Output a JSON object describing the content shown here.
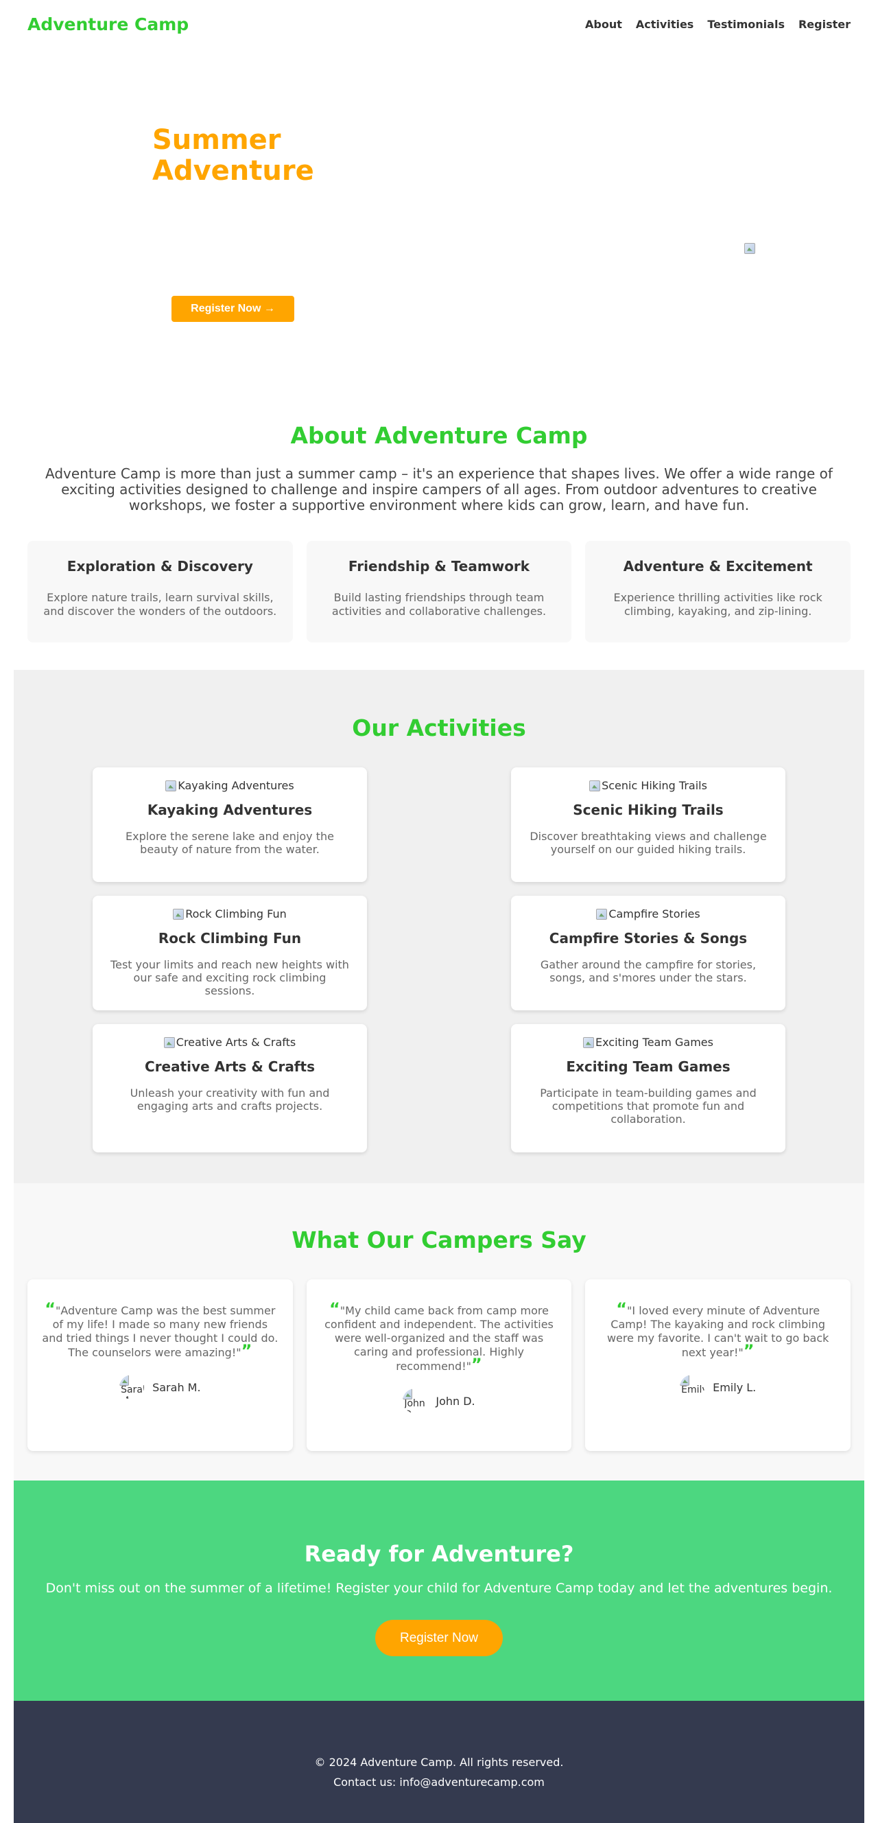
{
  "header": {
    "logo": "Adventure Camp",
    "nav": [
      "About",
      "Activities",
      "Testimonials",
      "Register"
    ]
  },
  "hero": {
    "title_line1": "Summer",
    "title_line2": "Adventure",
    "button": "Register Now →"
  },
  "about": {
    "title": "About Adventure Camp",
    "text": "Adventure Camp is more than just a summer camp – it's an experience that shapes lives. We offer a wide range of exciting activities designed to challenge and inspire campers of all ages. From outdoor adventures to creative workshops, we foster a supportive environment where kids can grow, learn, and have fun.",
    "features": [
      {
        "title": "Exploration & Discovery",
        "text": "Explore nature trails, learn survival skills, and discover the wonders of the outdoors."
      },
      {
        "title": "Friendship & Teamwork",
        "text": "Build lasting friendships through team activities and collaborative challenges."
      },
      {
        "title": "Adventure & Excitement",
        "text": "Experience thrilling activities like rock climbing, kayaking, and zip-lining."
      }
    ]
  },
  "activities": {
    "title": "Our Activities",
    "items": [
      {
        "alt": "Kayaking Adventures",
        "title": "Kayaking Adventures",
        "text": "Explore the serene lake and enjoy the beauty of nature from the water."
      },
      {
        "alt": "Scenic Hiking Trails",
        "title": "Scenic Hiking Trails",
        "text": "Discover breathtaking views and challenge yourself on our guided hiking trails."
      },
      {
        "alt": "Rock Climbing Fun",
        "title": "Rock Climbing Fun",
        "text": "Test your limits and reach new heights with our safe and exciting rock climbing sessions."
      },
      {
        "alt": "Campfire Stories",
        "title": "Campfire Stories & Songs",
        "text": "Gather around the campfire for stories, songs, and s'mores under the stars."
      },
      {
        "alt": "Creative Arts & Crafts",
        "title": "Creative Arts & Crafts",
        "text": "Unleash your creativity with fun and engaging arts and crafts projects."
      },
      {
        "alt": "Exciting Team Games",
        "title": "Exciting Team Games",
        "text": "Participate in team-building games and competitions that promote fun and collaboration."
      }
    ]
  },
  "testimonials": {
    "title": "What Our Campers Say",
    "open_quote": "“",
    "close_quote": "”",
    "items": [
      {
        "quote": "\"Adventure Camp was the best summer of my life! I made so many new friends and tried things I never thought I could do. The counselors were amazing!\"",
        "avatar_alt": "Sarah M.",
        "author": "Sarah M."
      },
      {
        "quote": "\"My child came back from camp more confident and independent. The activities were well-organized and the staff was caring and professional. Highly recommend!\"",
        "avatar_alt": "John D.",
        "author": "John D."
      },
      {
        "quote": "\"I loved every minute of Adventure Camp! The kayaking and rock climbing were my favorite. I can't wait to go back next year!\"",
        "avatar_alt": "Emily L.",
        "author": "Emily L."
      }
    ]
  },
  "cta": {
    "title": "Ready for Adventure?",
    "text": "Don't miss out on the summer of a lifetime! Register your child for Adventure Camp today and let the adventures begin.",
    "button": "Register Now"
  },
  "footer": {
    "copyright": "© 2024 Adventure Camp. All rights reserved.",
    "contact": "Contact us: info@adventurecamp.com"
  },
  "colors": {
    "brand_green": "#32cd32",
    "accent_orange": "#ffa500",
    "cta_green": "#4cd780",
    "footer_navy": "#343a4f"
  }
}
